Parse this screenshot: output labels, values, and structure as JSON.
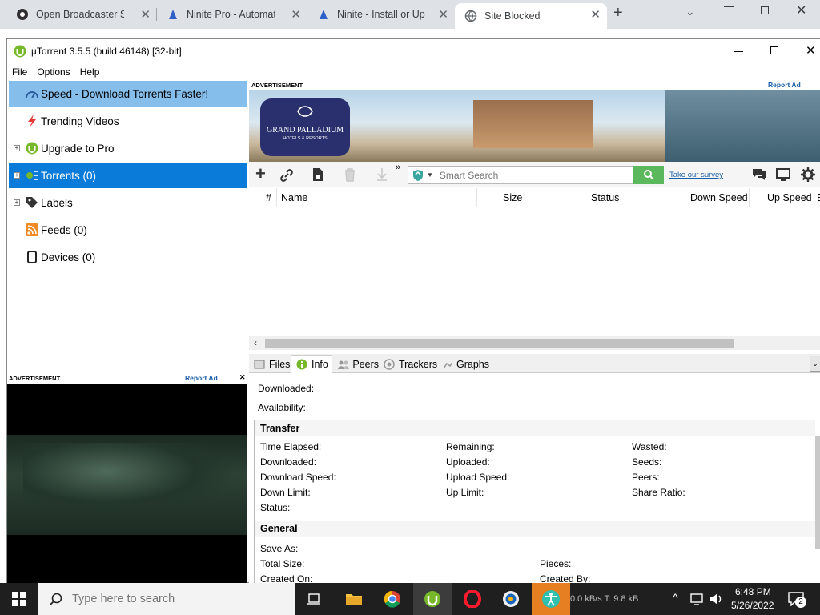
{
  "browser": {
    "tabs": [
      {
        "title": "Open Broadcaster Softw",
        "active": false
      },
      {
        "title": "Ninite Pro - Automatic",
        "active": false
      },
      {
        "title": "Ninite - Install or Upda",
        "active": false
      },
      {
        "title": "Site Blocked",
        "active": true
      }
    ],
    "new_tab_glyph": "+"
  },
  "window": {
    "title": "µTorrent 3.5.5  (build 46148) [32-bit]",
    "menu": [
      "File",
      "Options",
      "Help"
    ]
  },
  "sidebar": {
    "items": [
      {
        "label": "Speed - Download Torrents Faster!",
        "icon": "speed-icon",
        "selected": "light"
      },
      {
        "label": "Trending Videos",
        "icon": "lightning-icon"
      },
      {
        "label": "Upgrade to Pro",
        "icon": "utorrent-icon",
        "expandable": true
      },
      {
        "label": "Torrents (0)",
        "icon": "torrents-icon",
        "expandable": true,
        "selected": "dark"
      },
      {
        "label": "Labels",
        "icon": "tag-icon",
        "expandable": true
      },
      {
        "label": "Feeds (0)",
        "icon": "rss-icon"
      },
      {
        "label": "Devices (0)",
        "icon": "device-icon"
      }
    ]
  },
  "ads": {
    "left_label": "ADVERTISEMENT",
    "left_report": "Report Ad",
    "left_close": "✕",
    "top_label": "ADVERTISEMENT",
    "top_report": "Report Ad",
    "brand_line1": "GRAND PALLADIUM",
    "brand_line2": "HOTELS & RESORTS"
  },
  "toolbar": {
    "search_placeholder": "Smart Search",
    "survey_link": "Take our survey",
    "more": "»"
  },
  "list": {
    "columns": [
      "#",
      "Name",
      "Size",
      "Status",
      "Down Speed",
      "Up Speed",
      "E"
    ]
  },
  "detail_tabs": [
    "Files",
    "Info",
    "Peers",
    "Trackers",
    "Graphs"
  ],
  "info": {
    "downloaded": "Downloaded:",
    "availability": "Availability:",
    "transfer_title": "Transfer",
    "transfer": {
      "col1": [
        "Time Elapsed:",
        "Downloaded:",
        "Download Speed:",
        "Down Limit:",
        "Status:"
      ],
      "col2": [
        "Remaining:",
        "Uploaded:",
        "Upload Speed:",
        "Up Limit:"
      ],
      "col3": [
        "Wasted:",
        "Seeds:",
        "Peers:",
        "Share Ratio:"
      ]
    },
    "general_title": "General",
    "general": {
      "col1": [
        "Save As:",
        "Total Size:",
        "Created On:"
      ],
      "col2": [
        "Pieces:",
        "Created By:"
      ]
    }
  },
  "taskbar": {
    "search_placeholder": "Type here to search",
    "time": "6:48 PM",
    "date": "5/26/2022",
    "status_text": "0.0 kB/s T: 9.8 kB",
    "notification_count": "2"
  },
  "colors": {
    "selected_light": "#85bdeb",
    "selected_dark": "#0a7bd8",
    "utorrent_green": "#76b82a",
    "taskbar": "#1f1f1f"
  }
}
